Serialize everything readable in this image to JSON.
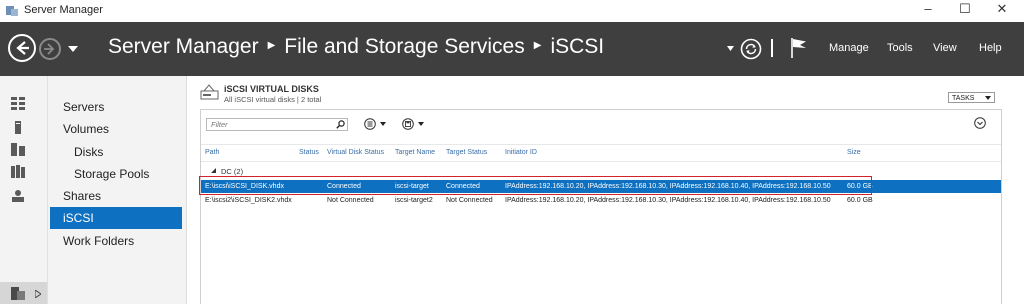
{
  "window": {
    "title": "Server Manager"
  },
  "window_controls": {
    "minimize": "–",
    "maximize": "☐",
    "close": "✕"
  },
  "breadcrumb": {
    "root": "Server Manager",
    "section": "File and Storage Services",
    "page": "iSCSI"
  },
  "header_menu": {
    "manage": "Manage",
    "tools": "Tools",
    "view": "View",
    "help": "Help"
  },
  "nav": {
    "servers": "Servers",
    "volumes": "Volumes",
    "disks": "Disks",
    "storage_pools": "Storage Pools",
    "shares": "Shares",
    "iscsi": "iSCSI",
    "work_folders": "Work Folders"
  },
  "tile": {
    "title": "iSCSI VIRTUAL DISKS",
    "subtitle": "All iSCSI virtual disks | 2 total",
    "tasks_label": "TASKS"
  },
  "filter": {
    "placeholder": "Filter"
  },
  "columns": [
    "Path",
    "Status",
    "Virtual Disk Status",
    "Target Name",
    "Target Status",
    "Initiator ID",
    "Size"
  ],
  "group": {
    "label": "DC (2)"
  },
  "rows": [
    {
      "path": "E:\\iscsi\\iSCSI_DISK.vhdx",
      "status": "",
      "vd_status": "Connected",
      "target_name": "iscsi-target",
      "target_status": "Connected",
      "initiator_id": "IPAddress:192.168.10.20, IPAddress:192.168.10.30, IPAddress:192.168.10.40, IPAddress:192.168.10.50",
      "size": "60.0 GB"
    },
    {
      "path": "E:\\iscsi2\\iSCSI_DISK2.vhdx",
      "status": "",
      "vd_status": "Not Connected",
      "target_name": "iscsi-target2",
      "target_status": "Not Connected",
      "initiator_id": "IPAddress:192.168.10.20, IPAddress:192.168.10.30, IPAddress:192.168.10.40, IPAddress:192.168.10.50",
      "size": "60.0 GB"
    }
  ],
  "colors": {
    "header_bg": "#3f3f3f",
    "selection": "#0e70c0",
    "highlight_border": "#d2232a",
    "column_header": "#3a6da8"
  }
}
